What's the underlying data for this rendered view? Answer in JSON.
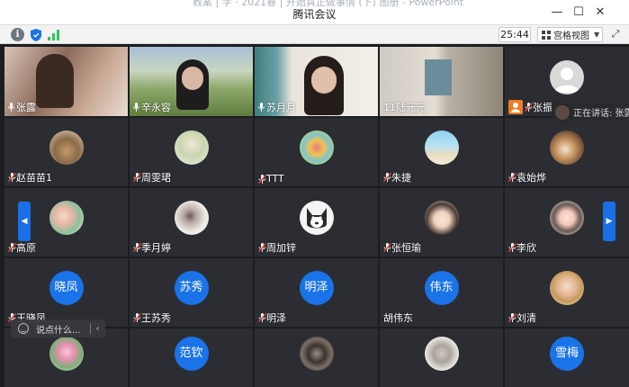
{
  "window": {
    "title": "腾讯会议",
    "background_title": "教案 | 学 · 2021春 | 开始真正做事情 (下) 图册 - PowerPoint"
  },
  "toolbar": {
    "timer": "25:44",
    "view_label": "宫格视图"
  },
  "speaking": {
    "label": "正在讲话: 张露"
  },
  "chat": {
    "placeholder": "说点什么..."
  },
  "colors": {
    "accent": "#1a73e8",
    "tile_bg": "#2b2d32",
    "mic_red": "#e0463a",
    "signal_green": "#2ec55b",
    "shield_blue": "#1a73e8"
  },
  "participants": {
    "row1": [
      {
        "name": "张露",
        "kind": "video"
      },
      {
        "name": "辛永容",
        "kind": "video"
      },
      {
        "name": "苏月月",
        "kind": "video"
      },
      {
        "name": "11陆元元",
        "kind": "video"
      },
      {
        "name": "张振",
        "kind": "avatar"
      }
    ],
    "row2": [
      "赵苗苗1",
      "周雯珺",
      "TTT",
      "朱捷",
      "袁始烨"
    ],
    "row3": [
      "高原",
      "季月婷",
      "周加锌",
      "张恒瑜",
      "李欣"
    ],
    "row4": [
      {
        "name": "王晓凤",
        "avatar_text": "晓凤"
      },
      {
        "name": "王苏秀",
        "avatar_text": "苏秀"
      },
      {
        "name": "明泽",
        "avatar_text": "明泽"
      },
      {
        "name": "胡伟东",
        "avatar_text": "伟东"
      },
      {
        "name": "刘清",
        "avatar_text": ""
      }
    ],
    "row5": [
      {
        "avatar_text": ""
      },
      {
        "avatar_text": "范钦"
      },
      {
        "avatar_text": ""
      },
      {
        "avatar_text": ""
      },
      {
        "avatar_text": "雪梅"
      }
    ]
  }
}
